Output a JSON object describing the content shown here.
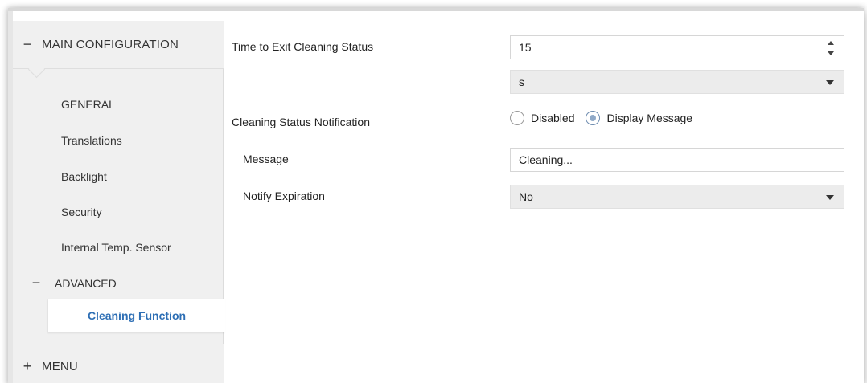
{
  "sidebar": {
    "main_group": {
      "sign": "−",
      "label": "MAIN CONFIGURATION"
    },
    "items": [
      {
        "label": "GENERAL"
      },
      {
        "label": "Translations"
      },
      {
        "label": "Backlight"
      },
      {
        "label": "Security"
      },
      {
        "label": "Internal Temp. Sensor"
      }
    ],
    "advanced": {
      "sign": "−",
      "label": "ADVANCED"
    },
    "active_item": {
      "label": "Cleaning Function"
    },
    "menu_group": {
      "sign": "+",
      "label": "MENU"
    }
  },
  "form": {
    "time_label": "Time to Exit Cleaning Status",
    "time_value": "15",
    "unit_value": "s",
    "notification_label": "Cleaning Status Notification",
    "notification_options": [
      "Disabled",
      "Display Message"
    ],
    "notification_selected": "Display Message",
    "message_label": "Message",
    "message_value": "Cleaning...",
    "expiration_label": "Notify Expiration",
    "expiration_value": "No"
  },
  "colors": {
    "accent": "#2e6fb5",
    "sidebar_bg": "#f0f0f0",
    "select_bg": "#ececec"
  }
}
